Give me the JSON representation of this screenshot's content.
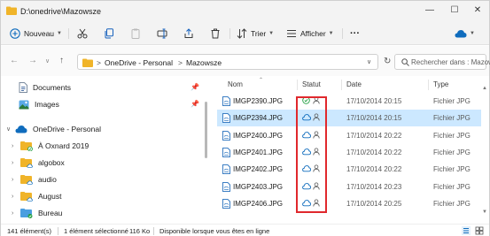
{
  "window": {
    "title": "D:\\onedrive\\Mazowsze",
    "minimize": "—",
    "maximize": "☐",
    "close": "✕"
  },
  "toolbar": {
    "new_label": "Nouveau",
    "sort_label": "Trier",
    "view_label": "Afficher",
    "more_label": "···"
  },
  "address": {
    "crumbs": [
      "OneDrive - Personal",
      "Mazowsze"
    ],
    "separator": ">",
    "search_placeholder": "Rechercher dans : Mazowsze"
  },
  "nav": {
    "pinned": [
      {
        "label": "Documents",
        "icon": "documents-icon"
      },
      {
        "label": "Images",
        "icon": "images-icon"
      }
    ],
    "onedrive_label": "OneDrive - Personal",
    "folders": [
      {
        "label": "À Oxnard 2019"
      },
      {
        "label": "algobox"
      },
      {
        "label": "audio"
      },
      {
        "label": "August"
      },
      {
        "label": "Bureau"
      }
    ]
  },
  "columns": {
    "name": "Nom",
    "status": "Statut",
    "date": "Date",
    "type": "Type"
  },
  "files": [
    {
      "name": "IMGP2390.JPG",
      "status": "available-locally",
      "date": "17/10/2014 20:15",
      "type": "Fichier JPG",
      "selected": false
    },
    {
      "name": "IMGP2394.JPG",
      "status": "online-only",
      "date": "17/10/2014 20:15",
      "type": "Fichier JPG",
      "selected": true
    },
    {
      "name": "IMGP2400.JPG",
      "status": "online-only",
      "date": "17/10/2014 20:22",
      "type": "Fichier JPG",
      "selected": false
    },
    {
      "name": "IMGP2401.JPG",
      "status": "online-only",
      "date": "17/10/2014 20:22",
      "type": "Fichier JPG",
      "selected": false
    },
    {
      "name": "IMGP2402.JPG",
      "status": "online-only",
      "date": "17/10/2014 20:22",
      "type": "Fichier JPG",
      "selected": false
    },
    {
      "name": "IMGP2403.JPG",
      "status": "online-only",
      "date": "17/10/2014 20:23",
      "type": "Fichier JPG",
      "selected": false
    },
    {
      "name": "IMGP2406.JPG",
      "status": "online-only",
      "date": "17/10/2014 20:25",
      "type": "Fichier JPG",
      "selected": false
    }
  ],
  "statusbar": {
    "count": "141 élément(s)",
    "selection": "1 élément sélectionné",
    "size": "116 Ko",
    "availability": "Disponible lorsque vous êtes en ligne"
  },
  "colors": {
    "accent": "#0078d4",
    "selection": "#cce8ff",
    "folder": "#f0b429",
    "highlight_box": "#e0282d",
    "status_green": "#1e9e3e"
  }
}
